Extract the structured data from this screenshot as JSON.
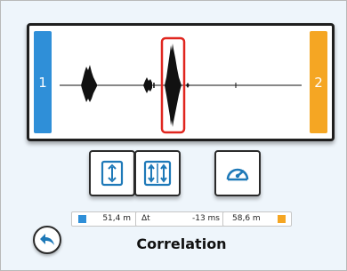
{
  "colors": {
    "sensor1": "#2f8fd8",
    "sensor2": "#f5a623",
    "highlight": "#e0261f",
    "icon": "#1e79b8"
  },
  "waveform": {
    "sensor1_label": "1",
    "sensor2_label": "2"
  },
  "toolbar": {
    "buttons": [
      {
        "icon": "vertical-arrow-icon"
      },
      {
        "icon": "dual-vertical-arrow-icon"
      },
      {
        "icon": "speedometer-icon"
      }
    ]
  },
  "info": {
    "left_distance": "51,4 m",
    "delta_label": "Δt",
    "delta_value": "-13 ms",
    "right_distance": "58,6 m"
  },
  "title": "Correlation",
  "back": {
    "icon": "back-arrow-icon"
  }
}
